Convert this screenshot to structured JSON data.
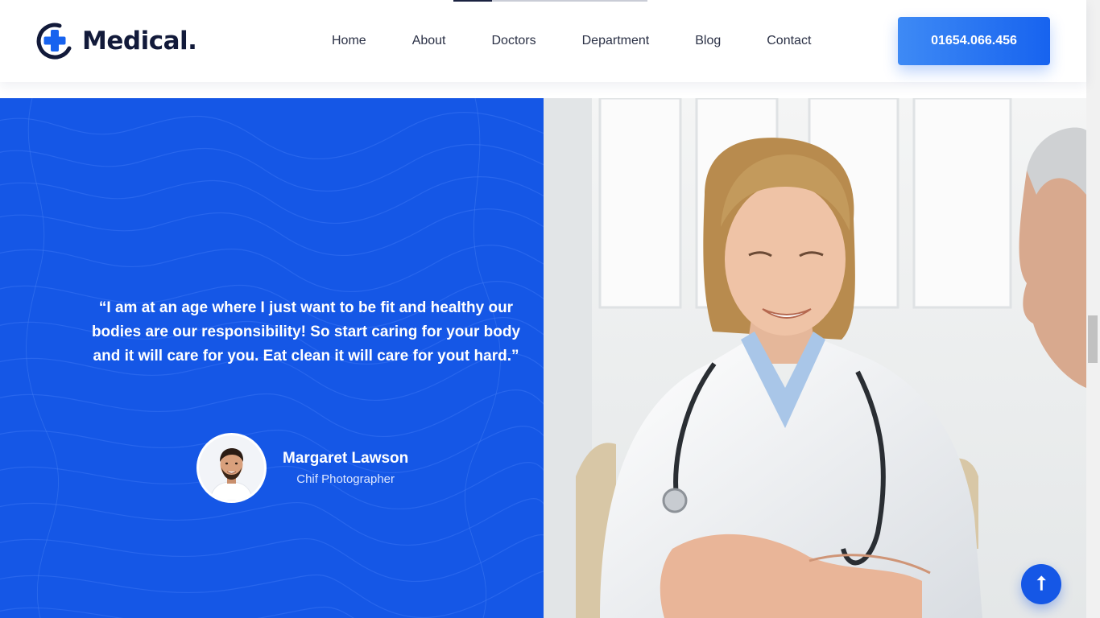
{
  "brand": {
    "name": "Medical."
  },
  "nav": {
    "items": [
      "Home",
      "About",
      "Doctors",
      "Department",
      "Blog",
      "Contact"
    ]
  },
  "header": {
    "phone": "01654.066.456"
  },
  "testimonial": {
    "quote": "“I am at an age where I just want to be fit and healthy our bodies are our responsibility! So start caring for your body and it will care for you. Eat clean it will care for yout hard.”",
    "author_name": "Margaret Lawson",
    "author_role": "Chif Photographer"
  },
  "back_to_top": {
    "icon": "arrow-up-icon",
    "glyph": "⭡"
  },
  "colors": {
    "primary": "#1557e6",
    "button_gradient_start": "#3e8af5",
    "button_gradient_end": "#1763ef",
    "text_dark": "#121a3a"
  }
}
